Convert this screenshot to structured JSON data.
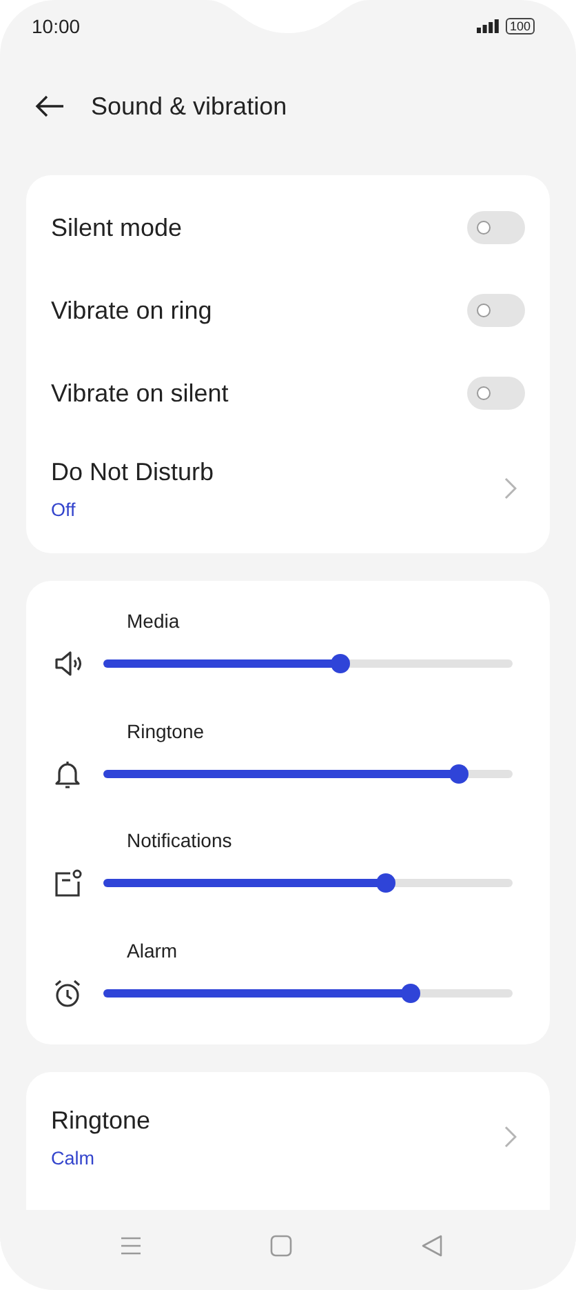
{
  "status_bar": {
    "time": "10:00",
    "battery": "100"
  },
  "header": {
    "title": "Sound & vibration"
  },
  "toggles": [
    {
      "label": "Silent mode",
      "on": false
    },
    {
      "label": "Vibrate on ring",
      "on": false
    },
    {
      "label": "Vibrate on silent",
      "on": false
    }
  ],
  "do_not_disturb": {
    "label": "Do Not Disturb",
    "value": "Off"
  },
  "volumes": [
    {
      "label": "Media",
      "kind": "speaker",
      "level": 0.58
    },
    {
      "label": "Ringtone",
      "kind": "bell",
      "level": 0.87
    },
    {
      "label": "Notifications",
      "kind": "notification",
      "level": 0.69
    },
    {
      "label": "Alarm",
      "kind": "alarm",
      "level": 0.75
    }
  ],
  "sound_items": [
    {
      "label": "Ringtone",
      "value": "Calm"
    }
  ]
}
